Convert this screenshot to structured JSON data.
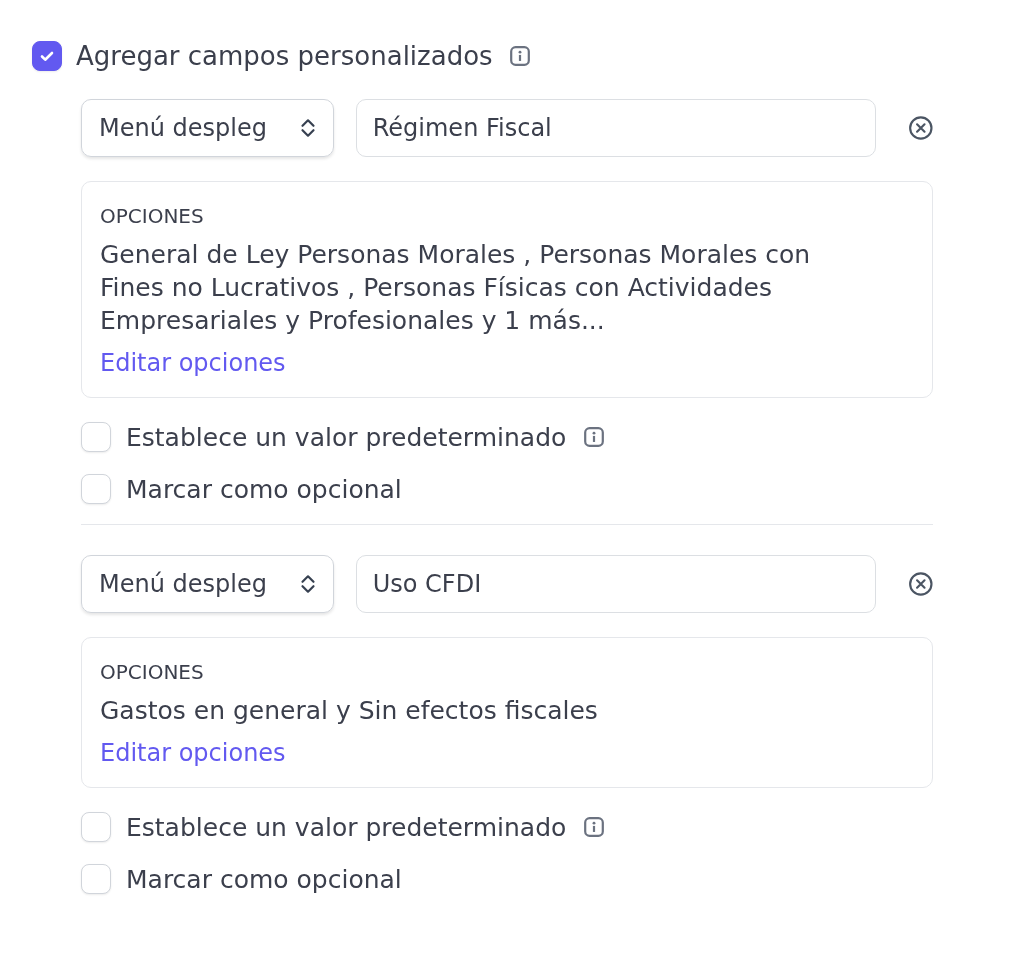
{
  "main_option": {
    "label": "Agregar campos personalizados",
    "checked": true
  },
  "fields": [
    {
      "type": "Menú despleg",
      "name": "Régimen Fiscal",
      "options_heading": "OPCIONES",
      "options_summary": "General de Ley Personas Morales , Personas Morales con Fines no Lucrativos , Personas Físicas con Actividades Empresariales y Profesionales y 1 más...",
      "edit_link": "Editar opciones",
      "checks": [
        {
          "label": "Establece un valor predeterminado",
          "checked": false,
          "info": true
        },
        {
          "label": "Marcar como opcional",
          "checked": false,
          "info": false
        }
      ]
    },
    {
      "type": "Menú despleg",
      "name": "Uso CFDI",
      "options_heading": "OPCIONES",
      "options_summary": "Gastos en general y Sin efectos fiscales",
      "edit_link": "Editar opciones",
      "checks": [
        {
          "label": "Establece un valor predeterminado",
          "checked": false,
          "info": true
        },
        {
          "label": "Marcar como opcional",
          "checked": false,
          "info": false
        }
      ]
    }
  ]
}
